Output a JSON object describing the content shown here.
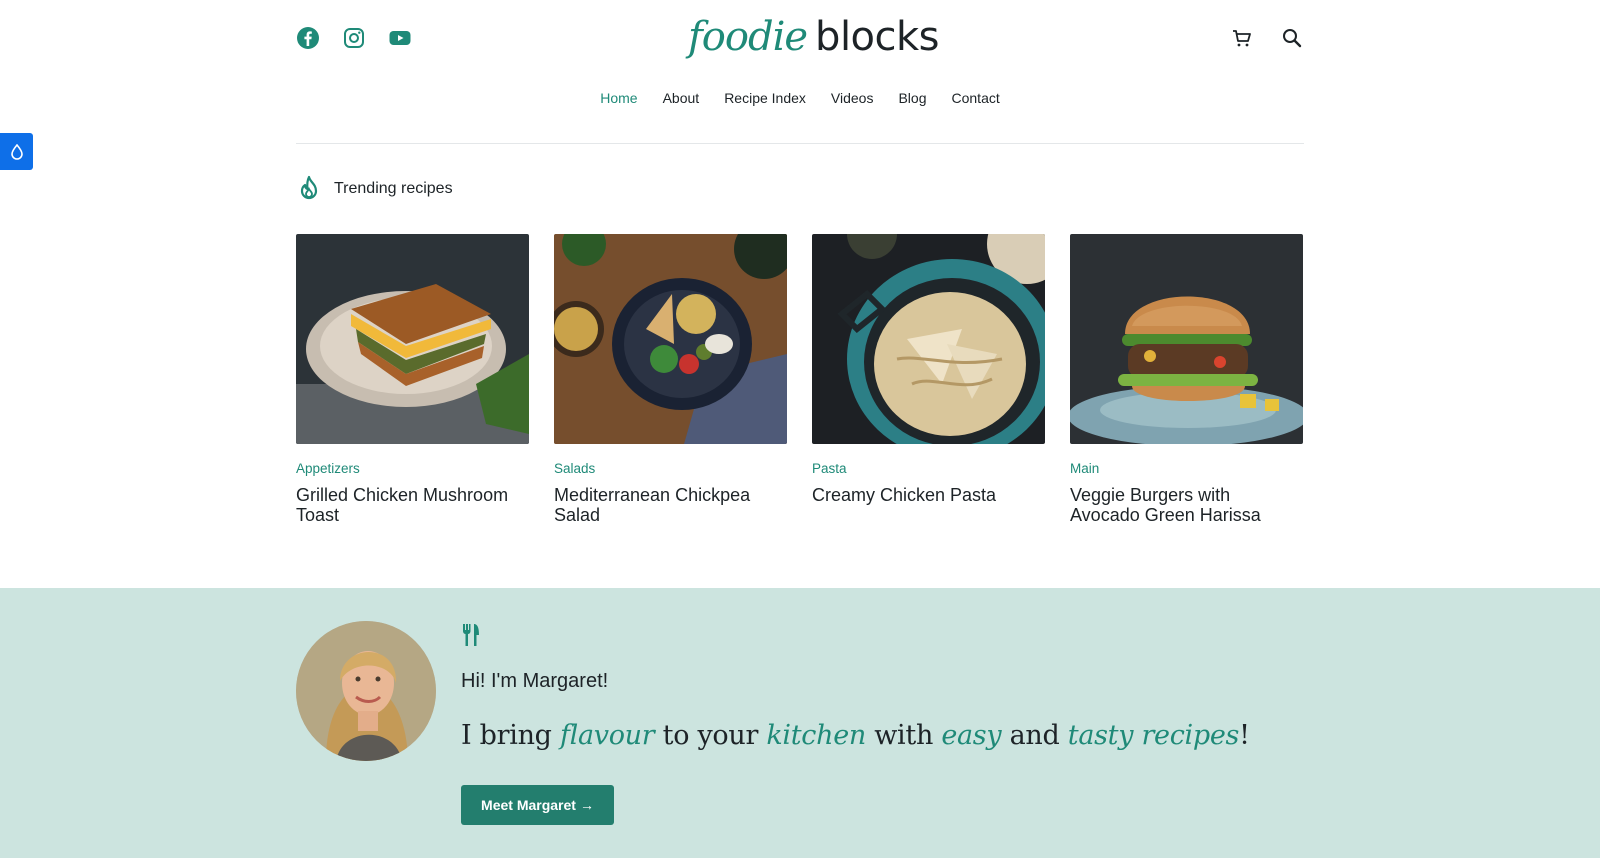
{
  "header": {
    "logo_script": "foodie",
    "logo_word": "blocks",
    "social": [
      "facebook-icon",
      "instagram-icon",
      "youtube-icon"
    ],
    "tools": [
      "cart-icon",
      "search-icon"
    ]
  },
  "nav": {
    "items": [
      {
        "label": "Home",
        "active": true
      },
      {
        "label": "About"
      },
      {
        "label": "Recipe Index"
      },
      {
        "label": "Videos"
      },
      {
        "label": "Blog"
      },
      {
        "label": "Contact"
      }
    ]
  },
  "trending": {
    "heading": "Trending recipes",
    "cards": [
      {
        "category": "Appetizers",
        "title": "Grilled Chicken Mushroom Toast",
        "image": "grilled-sandwich-photo"
      },
      {
        "category": "Salads",
        "title": "Mediterranean Chickpea Salad",
        "image": "chickpea-salad-photo"
      },
      {
        "category": "Pasta",
        "title": "Creamy Chicken Pasta",
        "image": "creamy-pasta-photo"
      },
      {
        "category": "Main",
        "title": "Veggie Burgers with Avocado Green Harissa",
        "image": "veggie-burger-photo"
      }
    ]
  },
  "about": {
    "greeting": "Hi! I'm Margaret!",
    "tagline_parts": [
      "I bring ",
      "flavour",
      " to your ",
      "kitchen",
      " with ",
      "easy",
      " and ",
      "tasty recipes",
      "!"
    ],
    "cta_label": "Meet Margaret",
    "cta_arrow": "→"
  },
  "colors": {
    "accent": "#1f8a78",
    "band_bg": "#cce4df",
    "button": "#237e6e",
    "side_tab": "#0e6fe8"
  }
}
